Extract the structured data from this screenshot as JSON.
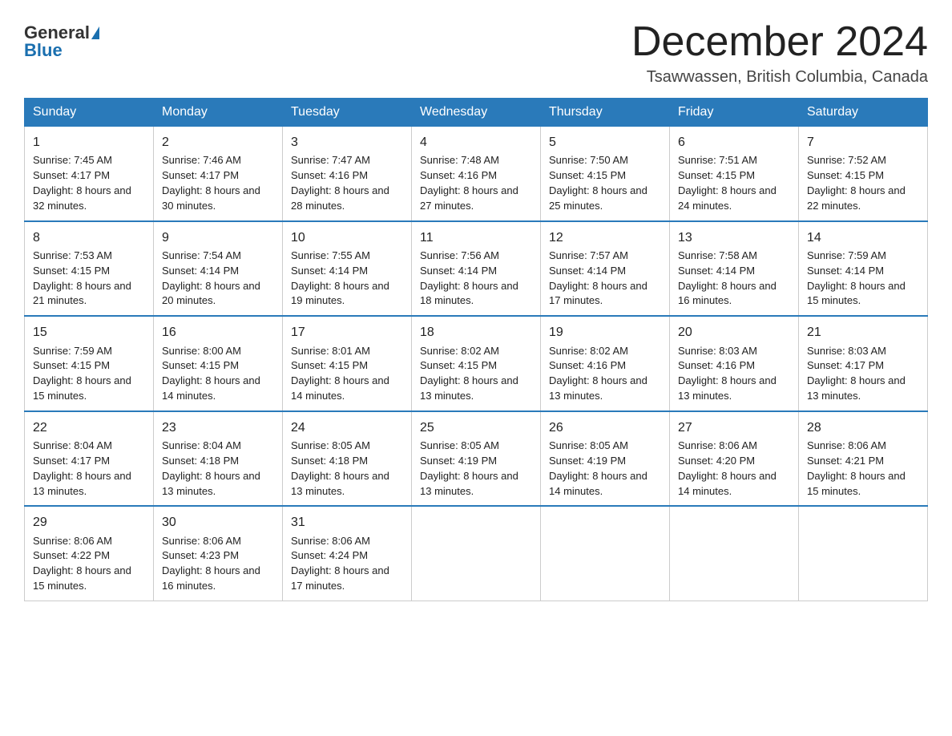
{
  "header": {
    "logo_general": "General",
    "logo_blue": "Blue",
    "month_title": "December 2024",
    "location": "Tsawwassen, British Columbia, Canada"
  },
  "days_of_week": [
    "Sunday",
    "Monday",
    "Tuesday",
    "Wednesday",
    "Thursday",
    "Friday",
    "Saturday"
  ],
  "weeks": [
    [
      {
        "day": "1",
        "sunrise": "7:45 AM",
        "sunset": "4:17 PM",
        "daylight": "8 hours and 32 minutes."
      },
      {
        "day": "2",
        "sunrise": "7:46 AM",
        "sunset": "4:17 PM",
        "daylight": "8 hours and 30 minutes."
      },
      {
        "day": "3",
        "sunrise": "7:47 AM",
        "sunset": "4:16 PM",
        "daylight": "8 hours and 28 minutes."
      },
      {
        "day": "4",
        "sunrise": "7:48 AM",
        "sunset": "4:16 PM",
        "daylight": "8 hours and 27 minutes."
      },
      {
        "day": "5",
        "sunrise": "7:50 AM",
        "sunset": "4:15 PM",
        "daylight": "8 hours and 25 minutes."
      },
      {
        "day": "6",
        "sunrise": "7:51 AM",
        "sunset": "4:15 PM",
        "daylight": "8 hours and 24 minutes."
      },
      {
        "day": "7",
        "sunrise": "7:52 AM",
        "sunset": "4:15 PM",
        "daylight": "8 hours and 22 minutes."
      }
    ],
    [
      {
        "day": "8",
        "sunrise": "7:53 AM",
        "sunset": "4:15 PM",
        "daylight": "8 hours and 21 minutes."
      },
      {
        "day": "9",
        "sunrise": "7:54 AM",
        "sunset": "4:14 PM",
        "daylight": "8 hours and 20 minutes."
      },
      {
        "day": "10",
        "sunrise": "7:55 AM",
        "sunset": "4:14 PM",
        "daylight": "8 hours and 19 minutes."
      },
      {
        "day": "11",
        "sunrise": "7:56 AM",
        "sunset": "4:14 PM",
        "daylight": "8 hours and 18 minutes."
      },
      {
        "day": "12",
        "sunrise": "7:57 AM",
        "sunset": "4:14 PM",
        "daylight": "8 hours and 17 minutes."
      },
      {
        "day": "13",
        "sunrise": "7:58 AM",
        "sunset": "4:14 PM",
        "daylight": "8 hours and 16 minutes."
      },
      {
        "day": "14",
        "sunrise": "7:59 AM",
        "sunset": "4:14 PM",
        "daylight": "8 hours and 15 minutes."
      }
    ],
    [
      {
        "day": "15",
        "sunrise": "7:59 AM",
        "sunset": "4:15 PM",
        "daylight": "8 hours and 15 minutes."
      },
      {
        "day": "16",
        "sunrise": "8:00 AM",
        "sunset": "4:15 PM",
        "daylight": "8 hours and 14 minutes."
      },
      {
        "day": "17",
        "sunrise": "8:01 AM",
        "sunset": "4:15 PM",
        "daylight": "8 hours and 14 minutes."
      },
      {
        "day": "18",
        "sunrise": "8:02 AM",
        "sunset": "4:15 PM",
        "daylight": "8 hours and 13 minutes."
      },
      {
        "day": "19",
        "sunrise": "8:02 AM",
        "sunset": "4:16 PM",
        "daylight": "8 hours and 13 minutes."
      },
      {
        "day": "20",
        "sunrise": "8:03 AM",
        "sunset": "4:16 PM",
        "daylight": "8 hours and 13 minutes."
      },
      {
        "day": "21",
        "sunrise": "8:03 AM",
        "sunset": "4:17 PM",
        "daylight": "8 hours and 13 minutes."
      }
    ],
    [
      {
        "day": "22",
        "sunrise": "8:04 AM",
        "sunset": "4:17 PM",
        "daylight": "8 hours and 13 minutes."
      },
      {
        "day": "23",
        "sunrise": "8:04 AM",
        "sunset": "4:18 PM",
        "daylight": "8 hours and 13 minutes."
      },
      {
        "day": "24",
        "sunrise": "8:05 AM",
        "sunset": "4:18 PM",
        "daylight": "8 hours and 13 minutes."
      },
      {
        "day": "25",
        "sunrise": "8:05 AM",
        "sunset": "4:19 PM",
        "daylight": "8 hours and 13 minutes."
      },
      {
        "day": "26",
        "sunrise": "8:05 AM",
        "sunset": "4:19 PM",
        "daylight": "8 hours and 14 minutes."
      },
      {
        "day": "27",
        "sunrise": "8:06 AM",
        "sunset": "4:20 PM",
        "daylight": "8 hours and 14 minutes."
      },
      {
        "day": "28",
        "sunrise": "8:06 AM",
        "sunset": "4:21 PM",
        "daylight": "8 hours and 15 minutes."
      }
    ],
    [
      {
        "day": "29",
        "sunrise": "8:06 AM",
        "sunset": "4:22 PM",
        "daylight": "8 hours and 15 minutes."
      },
      {
        "day": "30",
        "sunrise": "8:06 AM",
        "sunset": "4:23 PM",
        "daylight": "8 hours and 16 minutes."
      },
      {
        "day": "31",
        "sunrise": "8:06 AM",
        "sunset": "4:24 PM",
        "daylight": "8 hours and 17 minutes."
      },
      null,
      null,
      null,
      null
    ]
  ],
  "labels": {
    "sunrise_prefix": "Sunrise: ",
    "sunset_prefix": "Sunset: ",
    "daylight_prefix": "Daylight: "
  }
}
